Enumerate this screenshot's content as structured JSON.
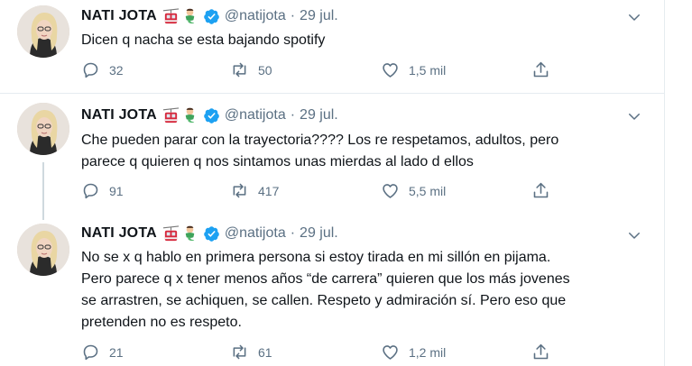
{
  "author": {
    "name": "NATI JOTA",
    "handle": "@natijota",
    "emoji_icons": [
      "cable-car-emoji-icon",
      "woman-genie-emoji-icon"
    ],
    "verified_icon": "verified-badge-icon"
  },
  "colors": {
    "text": "#0f1419",
    "secondary": "#5b7083",
    "verified": "#1da1f2",
    "divider": "#e6ecf0"
  },
  "tweets": [
    {
      "date": "29 jul.",
      "text": "Dicen q nacha se esta bajando spotify",
      "replies": "32",
      "retweets": "50",
      "likes": "1,5 mil"
    },
    {
      "date": "29 jul.",
      "text": "Che pueden parar con la trayectoria???? Los re respetamos, adultos, pero\nparece q quieren q nos sintamos unas mierdas al lado d ellos",
      "replies": "91",
      "retweets": "417",
      "likes": "5,5 mil"
    },
    {
      "date": "29 jul.",
      "text": "No se x q hablo en primera persona si estoy tirada en mi sillón en pijama.\nPero parece q x tener menos años “de carrera” quieren que los más jovenes\nse arrastren, se achiquen, se callen. Respeto y admiración sí. Pero eso que\npretenden no es respeto.",
      "replies": "21",
      "retweets": "61",
      "likes": "1,2 mil"
    }
  ]
}
